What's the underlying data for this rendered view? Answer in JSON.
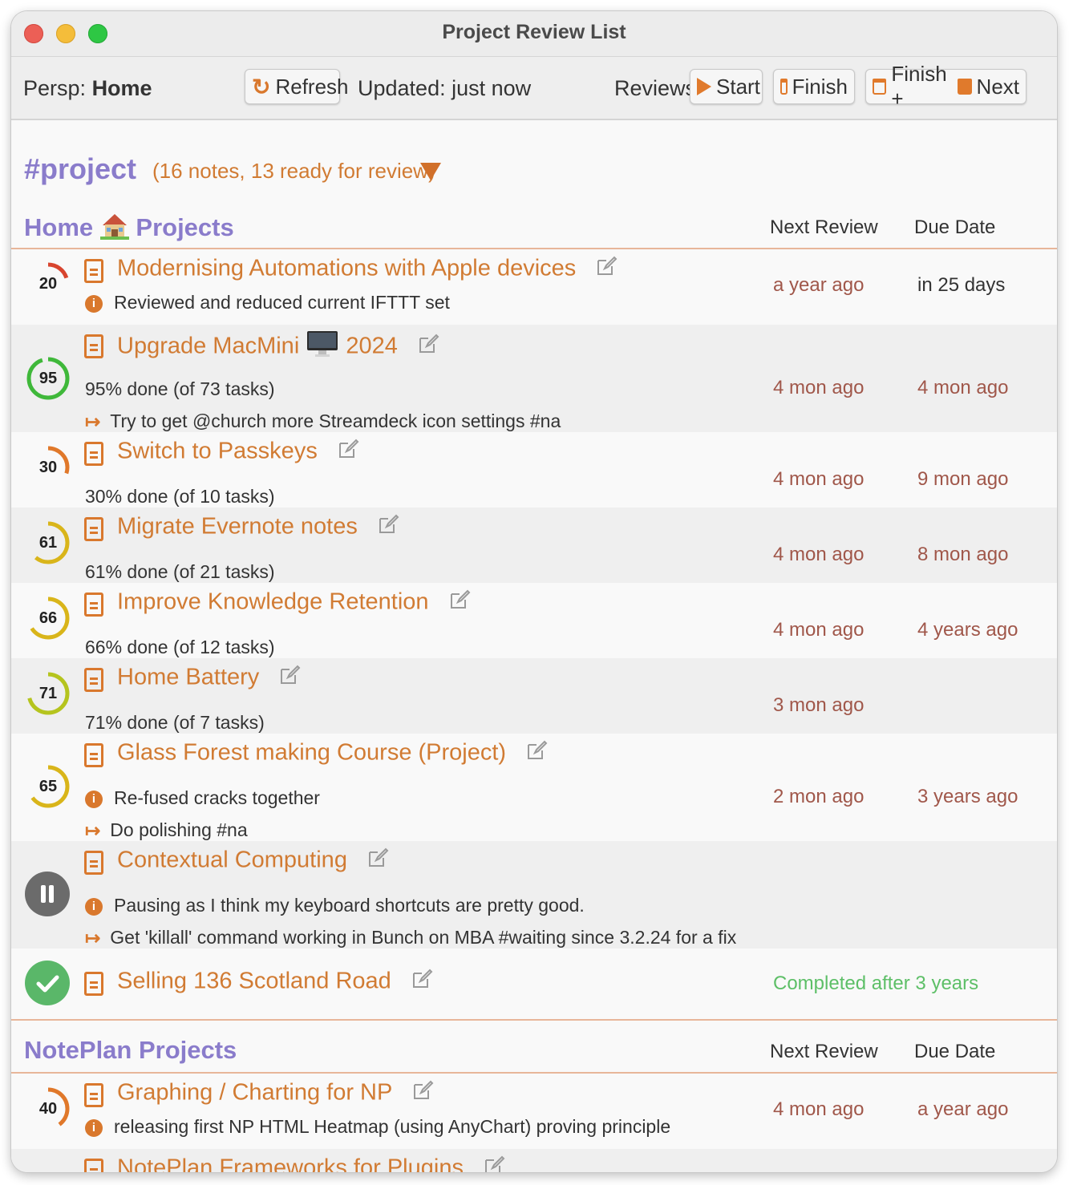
{
  "window": {
    "title": "Project Review List"
  },
  "toolbar": {
    "persp_label": "Persp:",
    "persp_value": "Home",
    "refresh_label": "Refresh",
    "updated": "Updated: just now",
    "reviews_label": "Reviews:",
    "start_label": "Start",
    "finish_label": "Finish",
    "finish_plus_label": "Finish +",
    "next_label": "Next"
  },
  "tag": {
    "name": "#project",
    "summary": "(16 notes, 13 ready for review)"
  },
  "colors": {
    "accent_orange": "#d17b33",
    "section_purple": "#8a7ccb",
    "overdue_text": "#a0574a",
    "complete_green": "#5dbf67"
  },
  "sections": [
    {
      "title": "Home",
      "title_suffix": "Projects",
      "col_next": "Next Review",
      "col_due": "Due Date",
      "projects": [
        {
          "title": "Modernising Automations with Apple devices",
          "progress": 20,
          "info": "Reviewed and reduced current IFTTT set",
          "next_review": "a year ago",
          "due": "in 25 days"
        },
        {
          "title": "Upgrade MacMini",
          "title_extra": "2024",
          "progress": 95,
          "detail": "95% done (of 73 tasks)",
          "next_action": "Try to get @church more Streamdeck icon settings #na",
          "next_review": "4 mon ago",
          "due": "4 mon ago"
        },
        {
          "title": "Switch to Passkeys",
          "progress": 30,
          "detail": "30% done (of 10 tasks)",
          "next_review": "4 mon ago",
          "due": "9 mon ago"
        },
        {
          "title": "Migrate Evernote notes",
          "progress": 61,
          "detail": "61% done (of 21 tasks)",
          "next_review": "4 mon ago",
          "due": "8 mon ago"
        },
        {
          "title": "Improve Knowledge Retention",
          "progress": 66,
          "detail": "66% done (of 12 tasks)",
          "next_review": "4 mon ago",
          "due": "4 years ago"
        },
        {
          "title": "Home Battery",
          "progress": 71,
          "detail": "71% done (of 7 tasks)",
          "next_review": "3 mon ago"
        },
        {
          "title": "Glass Forest making Course (Project)",
          "progress": 65,
          "info": "Re-fused cracks together",
          "next_action": "Do polishing #na",
          "next_review": "2 mon ago",
          "due": "3 years ago"
        },
        {
          "title": "Contextual Computing",
          "status": "paused",
          "info": "Pausing as I think my keyboard shortcuts are pretty good.",
          "next_action": "Get 'killall' command working in Bunch on MBA #waiting since 3.2.24 for a fix"
        },
        {
          "title": "Selling 136 Scotland Road",
          "status": "completed",
          "completed_text": "Completed after 3 years"
        }
      ]
    },
    {
      "title": "NotePlan Projects",
      "col_next": "Next Review",
      "col_due": "Due Date",
      "projects": [
        {
          "title": "Graphing / Charting for NP",
          "progress": 40,
          "info": "releasing first NP HTML Heatmap (using AnyChart) proving principle",
          "next_review": "4 mon ago",
          "due": "a year ago"
        },
        {
          "title": "NotePlan Frameworks for Plugins"
        }
      ]
    }
  ]
}
